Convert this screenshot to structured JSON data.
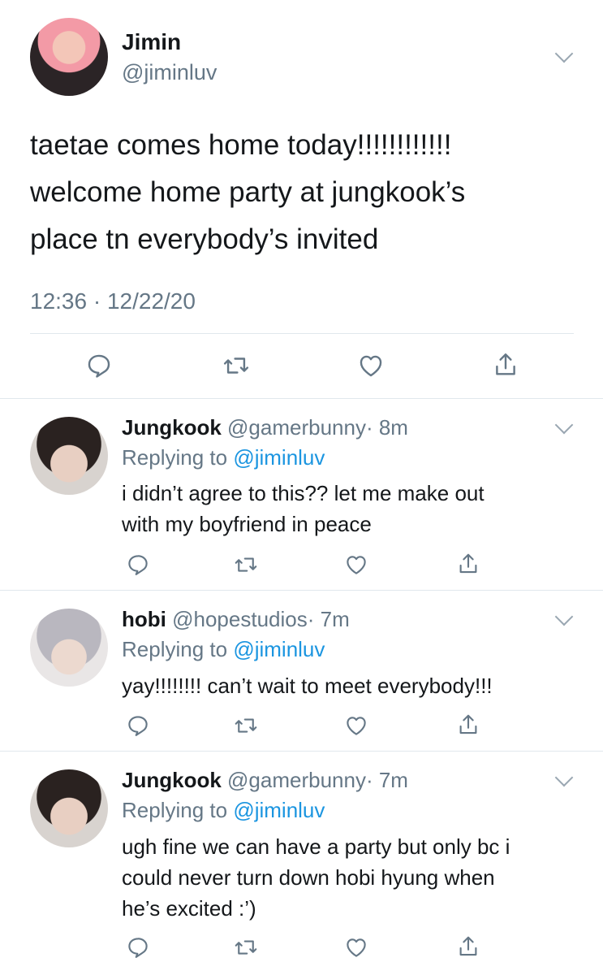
{
  "main_tweet": {
    "name": "Jimin",
    "handle": "@jiminluv",
    "text_lines": [
      "taetae comes home today!!!!!!!!!!!!",
      "welcome home party at jungkook’s",
      "place tn everybody’s invited"
    ],
    "timestamp": "12:36 · 12/22/20"
  },
  "replies": [
    {
      "name": "Jungkook",
      "handle": "@gamerbunny",
      "time": "· 8m",
      "replying_prefix": "Replying to",
      "replying_to": "@jiminluv",
      "text_lines": [
        "i didn’t agree to this?? let me make out",
        "with my boyfriend in peace"
      ]
    },
    {
      "name": "hobi",
      "handle": "@hopestudios",
      "time": "· 7m",
      "replying_prefix": "Replying to",
      "replying_to": "@jiminluv",
      "text_lines": [
        "yay!!!!!!!! can’t wait to meet everybody!!!"
      ]
    },
    {
      "name": "Jungkook",
      "handle": "@gamerbunny",
      "time": "· 7m",
      "replying_prefix": "Replying to",
      "replying_to": "@jiminluv",
      "text_lines": [
        "ugh fine we can have a party but only bc i",
        "could never turn down hobi hyung when",
        "he’s excited :’)"
      ]
    }
  ],
  "icons": {
    "reply": "reply-icon",
    "retweet": "retweet-icon",
    "like": "heart-icon",
    "share": "share-icon",
    "menu": "chevron-down-icon"
  },
  "colors": {
    "text": "#14171a",
    "secondary": "#657786",
    "link": "#1b95e0",
    "icon": "#657786",
    "divider": "#e1e8ed"
  }
}
